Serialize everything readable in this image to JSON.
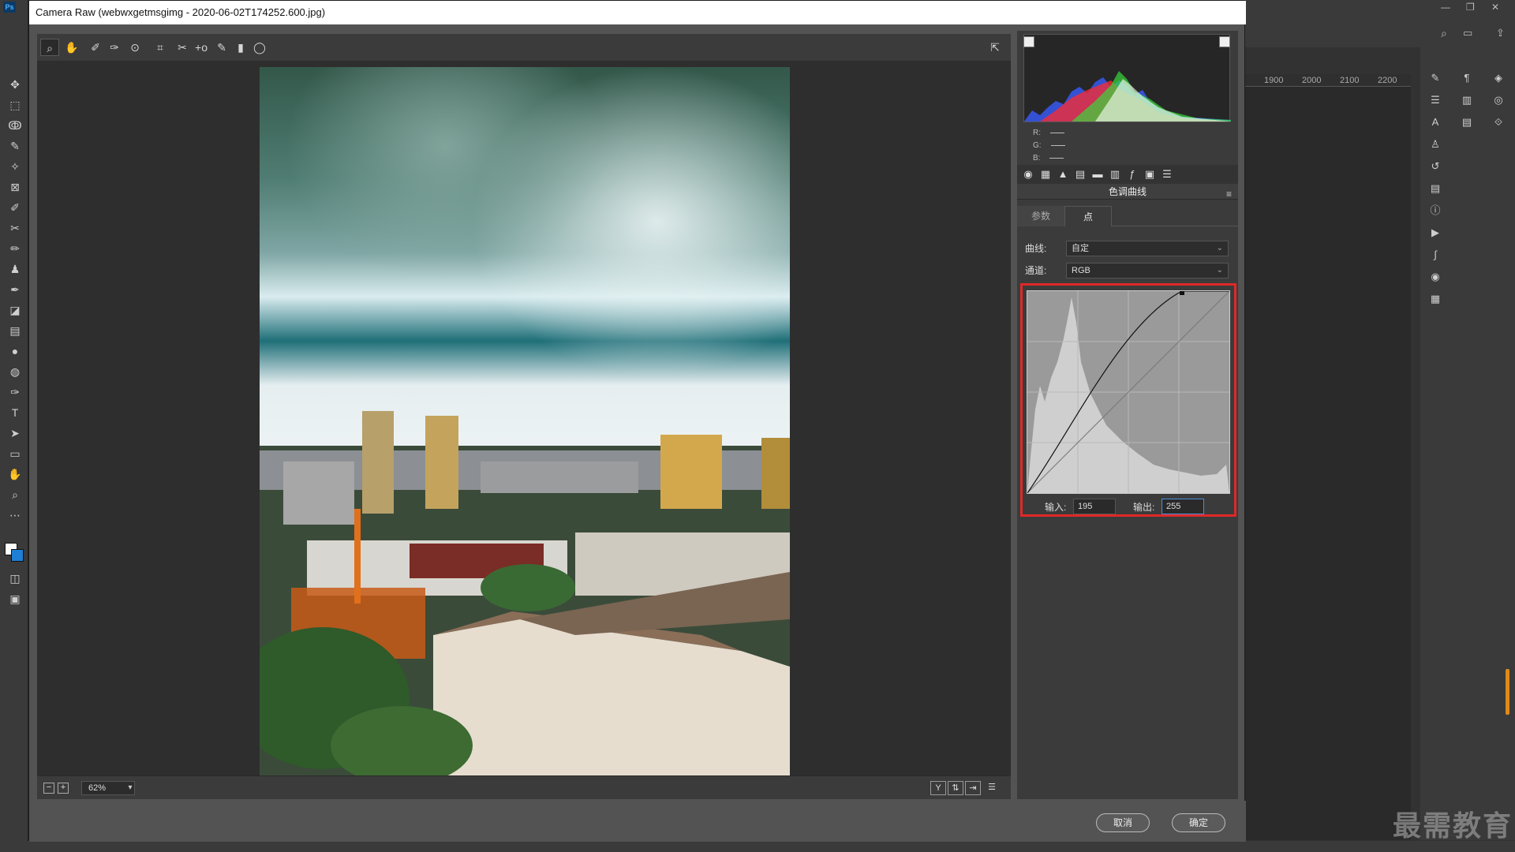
{
  "dialog": {
    "title": "Camera Raw (webwxgetmsgimg - 2020-06-02T174252.600.jpg)",
    "zoom": "62%",
    "cancel_label": "取消",
    "ok_label": "确定"
  },
  "ruler": {
    "labels": [
      "1900",
      "2000",
      "2100",
      "2200"
    ]
  },
  "readout": {
    "r_label": "R:",
    "g_label": "G:",
    "b_label": "B:"
  },
  "panel": {
    "title": "色调曲线",
    "tabs": [
      "参数",
      "点"
    ],
    "curve_label": "曲线:",
    "curve_value": "自定",
    "channel_label": "通道:",
    "channel_value": "RGB",
    "input_label": "输入:",
    "input_value": "195",
    "output_label": "输出:",
    "output_value": "255"
  },
  "view_buttons": [
    "Y"
  ],
  "watermark": "最需教育",
  "colors": {
    "highlight_frame": "#e02828",
    "accent": "#1e7fd6"
  }
}
